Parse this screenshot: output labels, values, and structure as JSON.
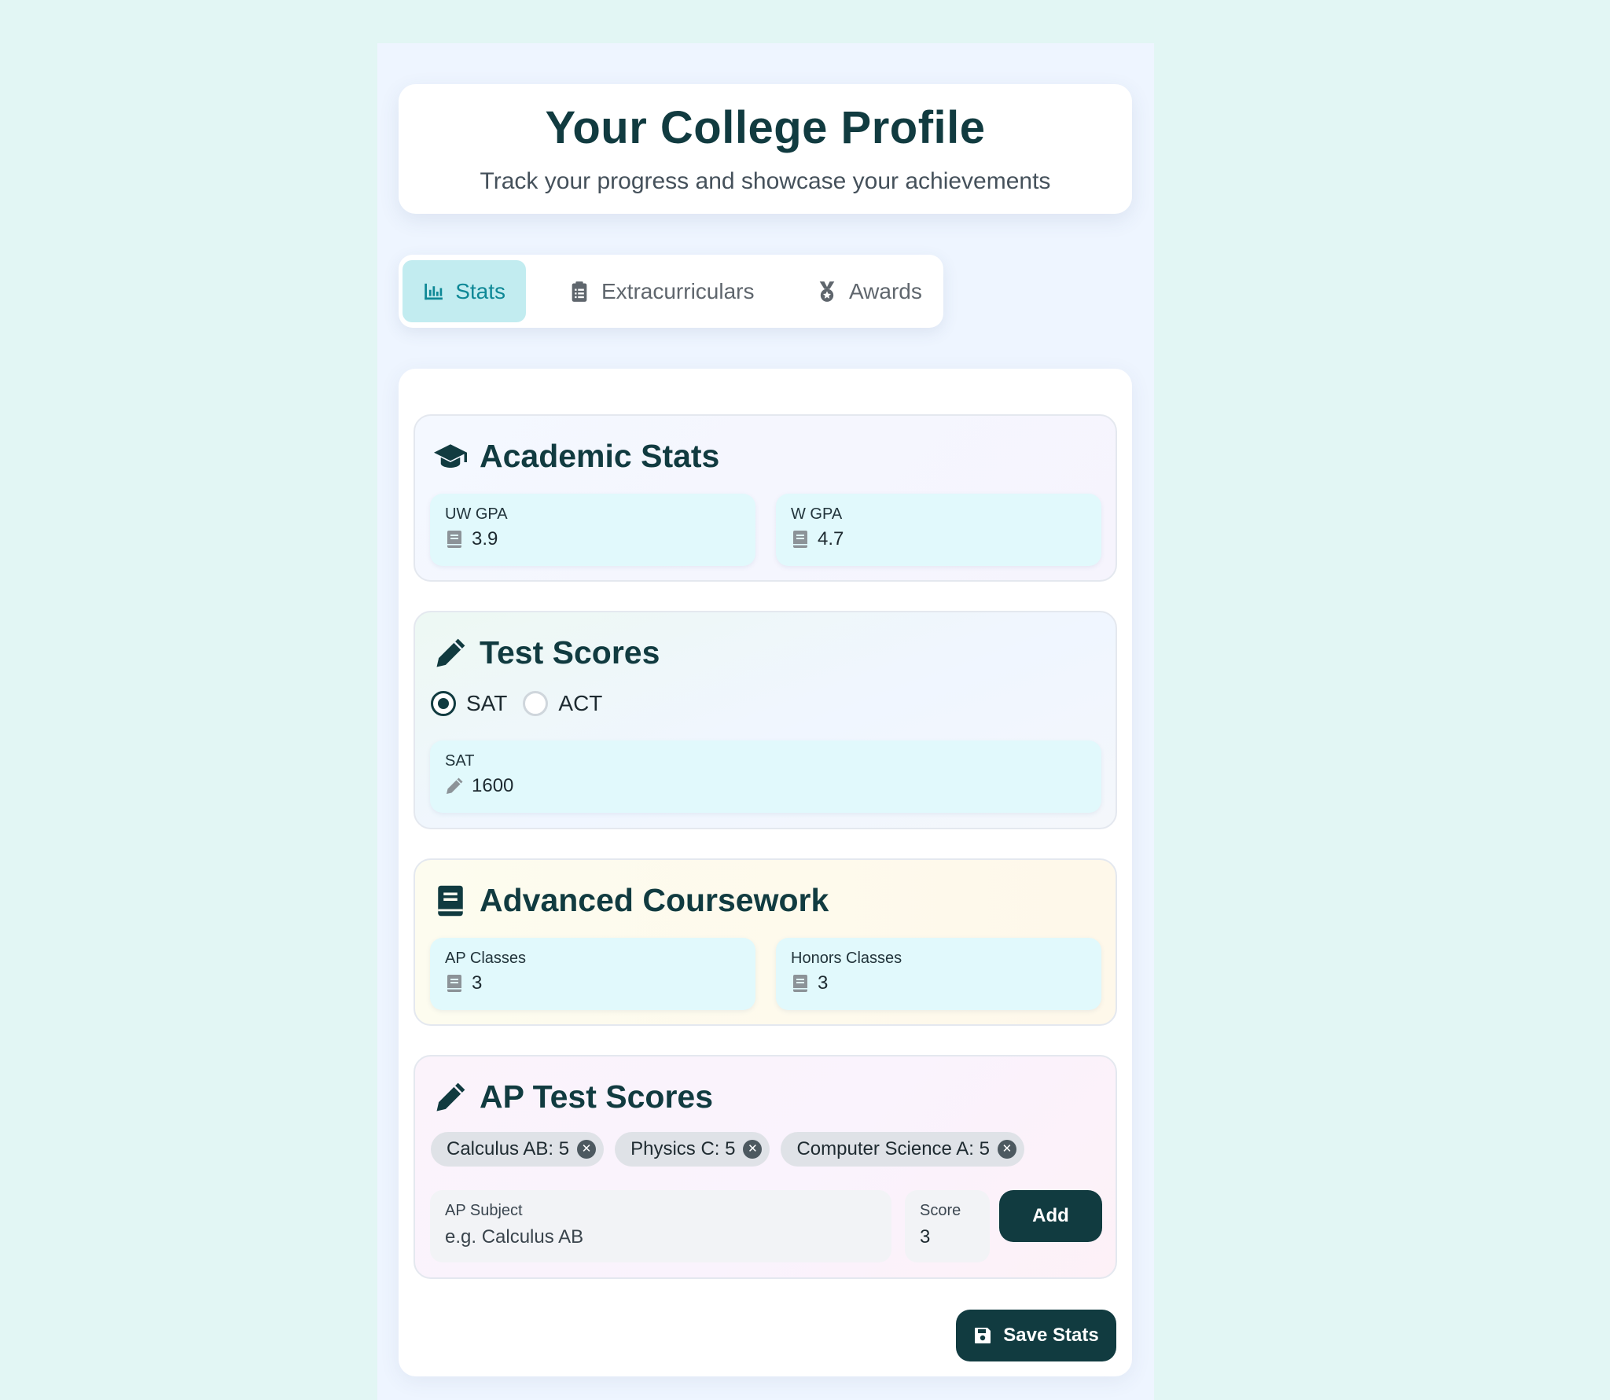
{
  "header": {
    "title": "Your College Profile",
    "subtitle": "Track your progress and showcase your achievements"
  },
  "tabs": [
    {
      "label": "Stats",
      "icon": "bar-chart-icon",
      "active": true
    },
    {
      "label": "Extracurriculars",
      "icon": "clipboard-icon",
      "active": false
    },
    {
      "label": "Awards",
      "icon": "medal-icon",
      "active": false
    }
  ],
  "academic": {
    "title": "Academic Stats",
    "icon": "graduation-cap-icon",
    "uw_gpa": {
      "label": "UW GPA",
      "value": "3.9",
      "icon": "book-icon"
    },
    "w_gpa": {
      "label": "W GPA",
      "value": "4.7",
      "icon": "book-icon"
    }
  },
  "tests": {
    "title": "Test Scores",
    "icon": "pencil-icon",
    "options": [
      "SAT",
      "ACT"
    ],
    "selected": "SAT",
    "score": {
      "label": "SAT",
      "value": "1600",
      "icon": "pencil-icon"
    }
  },
  "coursework": {
    "title": "Advanced Coursework",
    "icon": "book-icon",
    "ap": {
      "label": "AP Classes",
      "value": "3"
    },
    "honors": {
      "label": "Honors Classes",
      "value": "3"
    }
  },
  "ap_scores": {
    "title": "AP Test Scores",
    "icon": "pencil-icon",
    "chips": [
      "Calculus AB: 5",
      "Physics C: 5",
      "Computer Science A: 5"
    ],
    "subject_label": "AP Subject",
    "subject_placeholder": "e.g. Calculus AB",
    "score_label": "Score",
    "score_value": "3",
    "add_label": "Add"
  },
  "save_label": "Save Stats",
  "colors": {
    "background": "#e2f6f4",
    "primary": "#113b40",
    "active_tab": "#c2ecf0",
    "accent": "#0e8896",
    "field": "#e1f9fc"
  }
}
